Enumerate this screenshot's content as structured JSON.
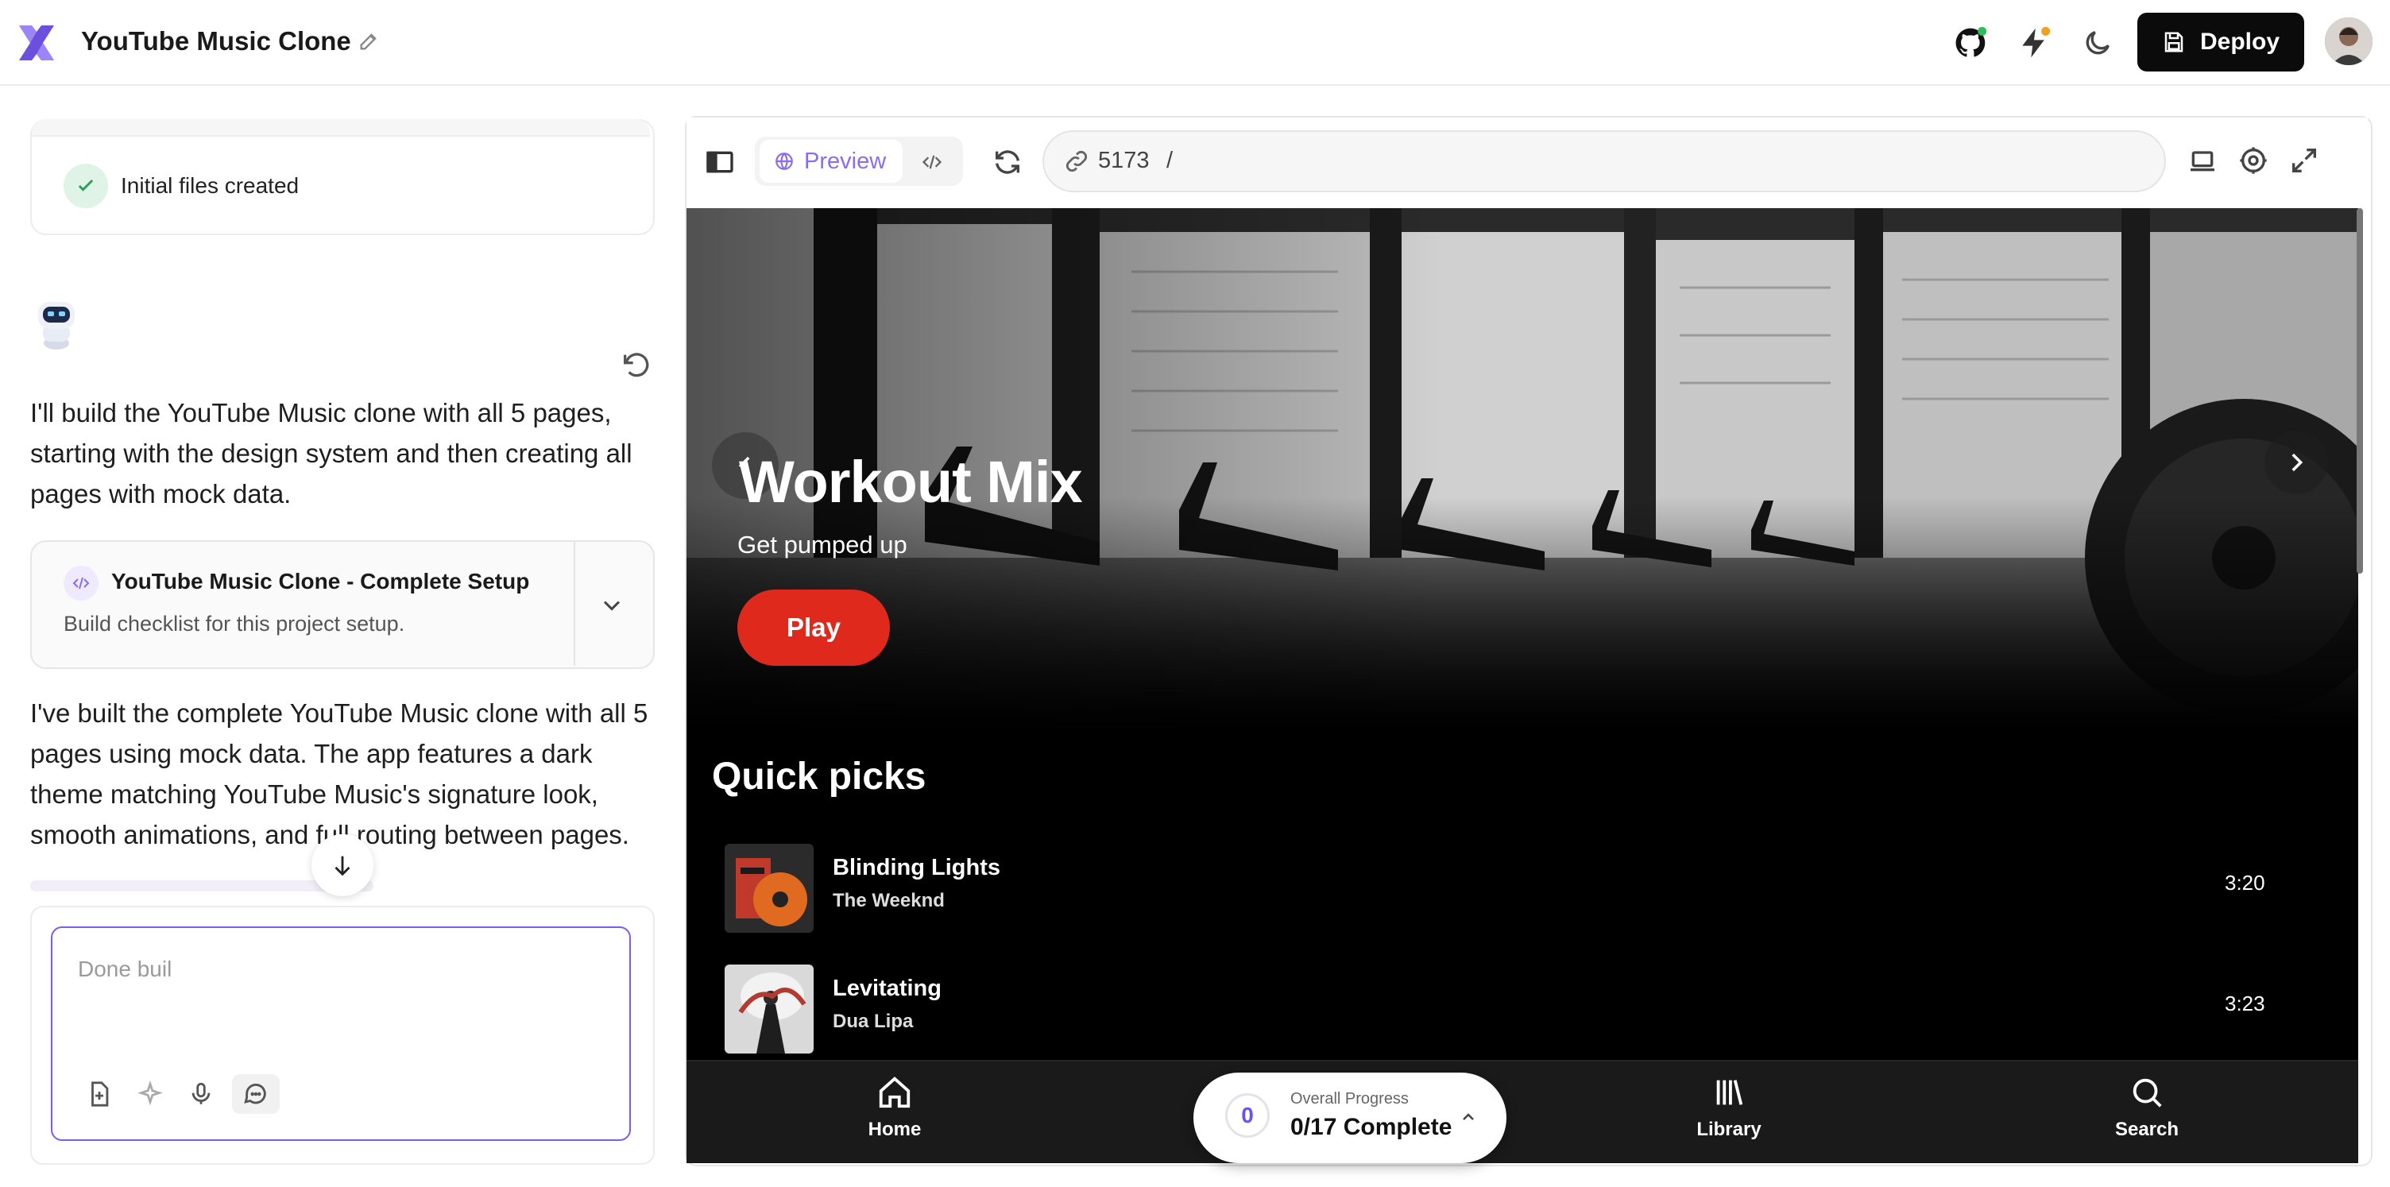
{
  "header": {
    "project_title": "YouTube Music Clone",
    "deploy_label": "Deploy"
  },
  "chat": {
    "files_status": "Initial files created",
    "message_1": "I'll build the YouTube Music clone with all 5 pages, starting with the design system and then creating all pages with mock data.",
    "artifact": {
      "title": "YouTube Music Clone - Complete Setup",
      "subtitle": "Build checklist for this project setup."
    },
    "message_2": "I've built the complete YouTube Music clone with all 5 pages using mock data. The app features a dark theme matching YouTube Music's signature look, smooth animations, and full routing between pages.",
    "input_value": "Done buil"
  },
  "preview": {
    "preview_tab_label": "Preview",
    "url_port": "5173",
    "url_path": "/"
  },
  "app": {
    "hero": {
      "title": "Workout Mix",
      "subtitle": "Get pumped up",
      "play_label": "Play"
    },
    "quick_picks_title": "Quick picks",
    "songs": [
      {
        "title": "Blinding Lights",
        "artist": "The Weeknd",
        "duration": "3:20"
      },
      {
        "title": "Levitating",
        "artist": "Dua Lipa",
        "duration": "3:23"
      }
    ],
    "nav": {
      "home": "Home",
      "library": "Library",
      "search": "Search"
    },
    "progress": {
      "count": "0",
      "label": "Overall Progress",
      "value": "0/17 Complete"
    }
  },
  "colors": {
    "accent_purple": "#7c5cf0",
    "play_red": "#e0291d",
    "check_green": "#2e9e5b",
    "app_background": "#000000"
  },
  "icons": {
    "logo": "x-logo-icon",
    "github": "github-icon",
    "bolt": "bolt-icon",
    "theme": "moon-icon",
    "save": "save-icon"
  }
}
